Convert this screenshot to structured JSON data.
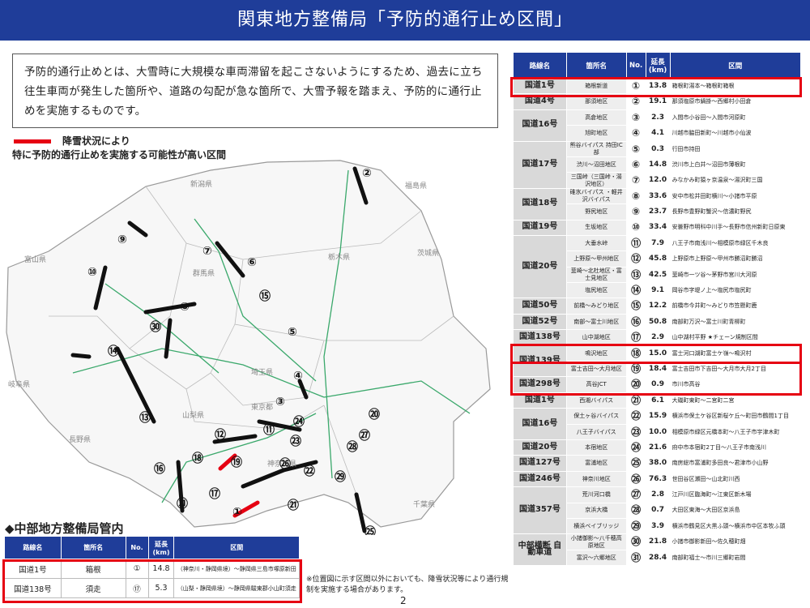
{
  "title": "関東地方整備局「予防的通行止め区間」",
  "intro": "予防的通行止めとは、大雪時に大規模な車両滞留を起こさないようにするため、過去に立ち往生車両が発生した箇所や、道路の勾配が急な箇所で、大雪予報を踏まえ、予防的に通行止めを実施するものです。",
  "legend": {
    "line1": "降雪状況により",
    "line2": "特に予防的通行止めを実施する可能性が高い区間",
    "color": "#e60012"
  },
  "map": {
    "prefectures": [
      "新潟県",
      "福島県",
      "栃木県",
      "群馬県",
      "茨城県",
      "富山県",
      "長野県",
      "埼玉県",
      "岐阜県",
      "山梨県",
      "東京都",
      "神奈川県",
      "千葉県"
    ],
    "markers": [
      "①",
      "②",
      "③",
      "④",
      "⑤",
      "⑥",
      "⑦",
      "⑧",
      "⑨",
      "⑩",
      "⑪",
      "⑫",
      "⑬",
      "⑭",
      "⑮",
      "⑯",
      "⑰",
      "⑱",
      "⑲",
      "⑳",
      "㉑",
      "㉒",
      "㉓",
      "㉔",
      "㉕",
      "㉖",
      "㉗",
      "㉘",
      "㉙",
      "㉚",
      "㉛"
    ]
  },
  "table": {
    "headers": [
      "路線名",
      "箇所名",
      "No.",
      "延長(km)",
      "区間"
    ],
    "rows": [
      {
        "route": "国道1号",
        "loc": "箱根新道",
        "no": "①",
        "km": "13.8",
        "sec": "箱根町湯本～箱根町箱根"
      },
      {
        "route": "国道4号",
        "loc": "那須地区",
        "no": "②",
        "km": "19.1",
        "sec": "那須塩原市鍋掛～西郷村小田倉"
      },
      {
        "route": "国道16号",
        "loc": "高倉地区",
        "no": "③",
        "km": "2.3",
        "sec": "入間市小谷田～入間市河原町"
      },
      {
        "route": "",
        "loc": "旭町地区",
        "no": "④",
        "km": "4.1",
        "sec": "川越市脇田新町～川越市小仙波"
      },
      {
        "route": "国道17号",
        "loc": "熊谷バイパス 持田IC部",
        "no": "⑤",
        "km": "0.3",
        "sec": "行田市持田"
      },
      {
        "route": "",
        "loc": "渋川～沼田地区",
        "no": "⑥",
        "km": "14.8",
        "sec": "渋川市上白井～沼田市薄根町"
      },
      {
        "route": "",
        "loc": "三国峠（三国峠・湯沢地区）",
        "no": "⑦",
        "km": "12.0",
        "sec": "みなかみ町猿ヶ京温泉～湯沢町三国"
      },
      {
        "route": "国道18号",
        "loc": "碓氷バイパス ・軽井沢バイパス",
        "no": "⑧",
        "km": "33.6",
        "sec": "安中市松井田町横川～小諸市平原"
      },
      {
        "route": "",
        "loc": "野尻地区",
        "no": "⑨",
        "km": "23.7",
        "sec": "長野市豊野町蟹沢～信濃町野尻"
      },
      {
        "route": "国道19号",
        "loc": "生坂地区",
        "no": "⑩",
        "km": "33.4",
        "sec": "安曇野市明科中川手～長野市信州新町日原東"
      },
      {
        "route": "国道20号",
        "loc": "大垂水峠",
        "no": "⑪",
        "km": "7.9",
        "sec": "八王子市南浅川～相模原市緑区千木良"
      },
      {
        "route": "",
        "loc": "上野原～甲州地区",
        "no": "⑫",
        "km": "45.8",
        "sec": "上野原市上野原～甲州市勝沼町勝沼"
      },
      {
        "route": "",
        "loc": "韮崎～北杜地区・富士見地区",
        "no": "⑬",
        "km": "42.5",
        "sec": "韮崎市一ツ谷～茅野市宮川大河原"
      },
      {
        "route": "",
        "loc": "塩尻地区",
        "no": "⑭",
        "km": "9.1",
        "sec": "岡谷市字堤ノ上～塩尻市塩尻町"
      },
      {
        "route": "国道50号",
        "loc": "前橋～みどり地区",
        "no": "⑮",
        "km": "12.2",
        "sec": "前橋市今井町～みどり市笠懸町鹿"
      },
      {
        "route": "国道52号",
        "loc": "南部～富士川地区",
        "no": "⑯",
        "km": "50.8",
        "sec": "南部町万沢～富士川町青柳町"
      },
      {
        "route": "国道138号",
        "loc": "山中湖地区",
        "no": "⑰",
        "km": "2.9",
        "sec": "山中湖村平野 ★チェーン規制区間"
      },
      {
        "route": "国道139号",
        "loc": "鳴沢地区",
        "no": "⑱",
        "km": "15.0",
        "sec": "富士河口湖町富士ケ嶺～鳴沢村"
      },
      {
        "route": "",
        "loc": "富士吉田～大月地区",
        "no": "⑲",
        "km": "18.4",
        "sec": "富士吉田市下吉田～大月市大月2丁目"
      },
      {
        "route": "国道298号",
        "loc": "高谷JCT",
        "no": "⑳",
        "km": "0.9",
        "sec": "市川市高谷"
      },
      {
        "route": "国道1号",
        "loc": "西湘バイパス",
        "no": "㉑",
        "km": "6.1",
        "sec": "大磯町東町～二宮町二宮"
      },
      {
        "route": "国道16号",
        "loc": "保土ヶ谷バイパス",
        "no": "㉒",
        "km": "15.9",
        "sec": "横浜市保土ケ谷区新桜ケ丘～町田市鶴間1丁目"
      },
      {
        "route": "",
        "loc": "八王子バイパス",
        "no": "㉓",
        "km": "10.0",
        "sec": "相模原市緑区元橋本町～八王子市宇津木町"
      },
      {
        "route": "国道20号",
        "loc": "本宿地区",
        "no": "㉔",
        "km": "21.6",
        "sec": "府中市本宿町2丁目～八王子市南浅川"
      },
      {
        "route": "国道127号",
        "loc": "富浦地区",
        "no": "㉕",
        "km": "38.0",
        "sec": "南房総市富浦町多田良～君津市小山野"
      },
      {
        "route": "国道246号",
        "loc": "神奈川地区",
        "no": "㉖",
        "km": "76.3",
        "sec": "世田谷区瀬田～山北町川西"
      },
      {
        "route": "国道357号",
        "loc": "荒川河口橋",
        "no": "㉗",
        "km": "2.8",
        "sec": "江戸川区臨海町～江東区新木場"
      },
      {
        "route": "",
        "loc": "京浜大橋",
        "no": "㉘",
        "km": "0.7",
        "sec": "大田区東海～大田区京浜島"
      },
      {
        "route": "",
        "loc": "横浜ベイブリッジ",
        "no": "㉙",
        "km": "3.9",
        "sec": "横浜市鶴見区大黒ふ頭～横浜市中区本牧ふ頭"
      },
      {
        "route": "中部横断 自動車道",
        "loc": "小諸御影～八千穂高原地区",
        "no": "㉚",
        "km": "21.8",
        "sec": "小諸市御影新田～佐久穂町畑"
      },
      {
        "route": "",
        "loc": "富沢～六郷地区",
        "no": "㉛",
        "km": "28.4",
        "sec": "南部町福士～市川三郷町岩間"
      }
    ]
  },
  "chubu": {
    "title": "◆中部地方整備局管内",
    "headers": [
      "路線名",
      "箇所名",
      "No.",
      "延長(km)",
      "区間"
    ],
    "rows": [
      {
        "route": "国道1号",
        "loc": "箱根",
        "no": "①",
        "km": "14.8",
        "sec": "（神奈川・静岡県境）～静岡県三島市塚原新田"
      },
      {
        "route": "国道138号",
        "loc": "須走",
        "no": "⑰",
        "km": "5.3",
        "sec": "（山梨・静岡県境）～静岡県駿東郡小山町須走"
      }
    ]
  },
  "note": "※位置図に示す区間以外においても、降雪状況等により通行規制を実施する場合があります。",
  "page": "2"
}
